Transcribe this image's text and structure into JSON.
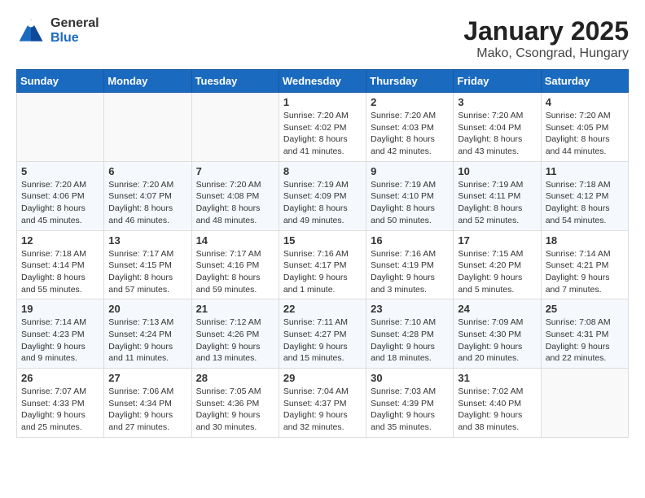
{
  "logo": {
    "general": "General",
    "blue": "Blue"
  },
  "title": "January 2025",
  "subtitle": "Mako, Csongrad, Hungary",
  "weekdays": [
    "Sunday",
    "Monday",
    "Tuesday",
    "Wednesday",
    "Thursday",
    "Friday",
    "Saturday"
  ],
  "weeks": [
    [
      {
        "day": "",
        "info": ""
      },
      {
        "day": "",
        "info": ""
      },
      {
        "day": "",
        "info": ""
      },
      {
        "day": "1",
        "info": "Sunrise: 7:20 AM\nSunset: 4:02 PM\nDaylight: 8 hours and 41 minutes."
      },
      {
        "day": "2",
        "info": "Sunrise: 7:20 AM\nSunset: 4:03 PM\nDaylight: 8 hours and 42 minutes."
      },
      {
        "day": "3",
        "info": "Sunrise: 7:20 AM\nSunset: 4:04 PM\nDaylight: 8 hours and 43 minutes."
      },
      {
        "day": "4",
        "info": "Sunrise: 7:20 AM\nSunset: 4:05 PM\nDaylight: 8 hours and 44 minutes."
      }
    ],
    [
      {
        "day": "5",
        "info": "Sunrise: 7:20 AM\nSunset: 4:06 PM\nDaylight: 8 hours and 45 minutes."
      },
      {
        "day": "6",
        "info": "Sunrise: 7:20 AM\nSunset: 4:07 PM\nDaylight: 8 hours and 46 minutes."
      },
      {
        "day": "7",
        "info": "Sunrise: 7:20 AM\nSunset: 4:08 PM\nDaylight: 8 hours and 48 minutes."
      },
      {
        "day": "8",
        "info": "Sunrise: 7:19 AM\nSunset: 4:09 PM\nDaylight: 8 hours and 49 minutes."
      },
      {
        "day": "9",
        "info": "Sunrise: 7:19 AM\nSunset: 4:10 PM\nDaylight: 8 hours and 50 minutes."
      },
      {
        "day": "10",
        "info": "Sunrise: 7:19 AM\nSunset: 4:11 PM\nDaylight: 8 hours and 52 minutes."
      },
      {
        "day": "11",
        "info": "Sunrise: 7:18 AM\nSunset: 4:12 PM\nDaylight: 8 hours and 54 minutes."
      }
    ],
    [
      {
        "day": "12",
        "info": "Sunrise: 7:18 AM\nSunset: 4:14 PM\nDaylight: 8 hours and 55 minutes."
      },
      {
        "day": "13",
        "info": "Sunrise: 7:17 AM\nSunset: 4:15 PM\nDaylight: 8 hours and 57 minutes."
      },
      {
        "day": "14",
        "info": "Sunrise: 7:17 AM\nSunset: 4:16 PM\nDaylight: 8 hours and 59 minutes."
      },
      {
        "day": "15",
        "info": "Sunrise: 7:16 AM\nSunset: 4:17 PM\nDaylight: 9 hours and 1 minute."
      },
      {
        "day": "16",
        "info": "Sunrise: 7:16 AM\nSunset: 4:19 PM\nDaylight: 9 hours and 3 minutes."
      },
      {
        "day": "17",
        "info": "Sunrise: 7:15 AM\nSunset: 4:20 PM\nDaylight: 9 hours and 5 minutes."
      },
      {
        "day": "18",
        "info": "Sunrise: 7:14 AM\nSunset: 4:21 PM\nDaylight: 9 hours and 7 minutes."
      }
    ],
    [
      {
        "day": "19",
        "info": "Sunrise: 7:14 AM\nSunset: 4:23 PM\nDaylight: 9 hours and 9 minutes."
      },
      {
        "day": "20",
        "info": "Sunrise: 7:13 AM\nSunset: 4:24 PM\nDaylight: 9 hours and 11 minutes."
      },
      {
        "day": "21",
        "info": "Sunrise: 7:12 AM\nSunset: 4:26 PM\nDaylight: 9 hours and 13 minutes."
      },
      {
        "day": "22",
        "info": "Sunrise: 7:11 AM\nSunset: 4:27 PM\nDaylight: 9 hours and 15 minutes."
      },
      {
        "day": "23",
        "info": "Sunrise: 7:10 AM\nSunset: 4:28 PM\nDaylight: 9 hours and 18 minutes."
      },
      {
        "day": "24",
        "info": "Sunrise: 7:09 AM\nSunset: 4:30 PM\nDaylight: 9 hours and 20 minutes."
      },
      {
        "day": "25",
        "info": "Sunrise: 7:08 AM\nSunset: 4:31 PM\nDaylight: 9 hours and 22 minutes."
      }
    ],
    [
      {
        "day": "26",
        "info": "Sunrise: 7:07 AM\nSunset: 4:33 PM\nDaylight: 9 hours and 25 minutes."
      },
      {
        "day": "27",
        "info": "Sunrise: 7:06 AM\nSunset: 4:34 PM\nDaylight: 9 hours and 27 minutes."
      },
      {
        "day": "28",
        "info": "Sunrise: 7:05 AM\nSunset: 4:36 PM\nDaylight: 9 hours and 30 minutes."
      },
      {
        "day": "29",
        "info": "Sunrise: 7:04 AM\nSunset: 4:37 PM\nDaylight: 9 hours and 32 minutes."
      },
      {
        "day": "30",
        "info": "Sunrise: 7:03 AM\nSunset: 4:39 PM\nDaylight: 9 hours and 35 minutes."
      },
      {
        "day": "31",
        "info": "Sunrise: 7:02 AM\nSunset: 4:40 PM\nDaylight: 9 hours and 38 minutes."
      },
      {
        "day": "",
        "info": ""
      }
    ]
  ]
}
